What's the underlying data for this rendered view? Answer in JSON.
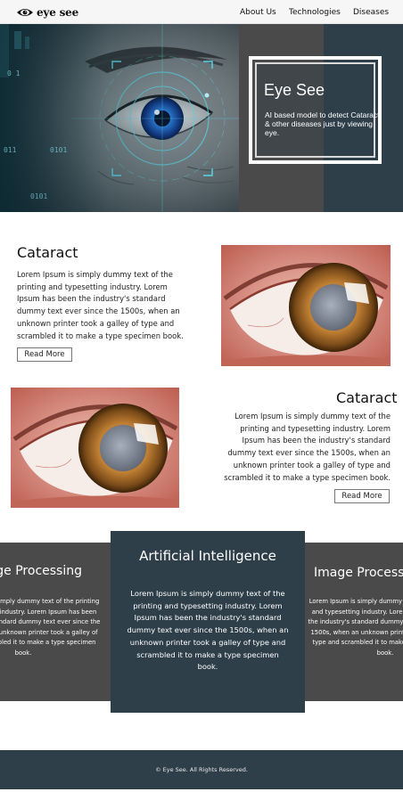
{
  "nav": {
    "logo_text": "eye see",
    "links": [
      "About Us",
      "Technologies",
      "Diseases"
    ]
  },
  "hero": {
    "title": "Eye See",
    "subtitle": "AI based model to detect Cataract & other diseases just by viewing eye.",
    "overlay_digits": [
      "0 1",
      "011",
      "0101",
      "0101"
    ]
  },
  "sections": [
    {
      "title": "Cataract",
      "body": "Lorem Ipsum is simply dummy text of the printing and typesetting industry. Lorem Ipsum has been the industry's standard dummy text ever since the 1500s, when an unknown printer took a galley of type and scrambled it to make a type specimen book.",
      "button": "Read More"
    },
    {
      "title": "Cataract",
      "body": "Lorem Ipsum is simply dummy text of the printing and typesetting industry. Lorem Ipsum has been the industry's standard dummy text ever since the 1500s, when an unknown printer took a galley of type and scrambled it to make a type specimen book.",
      "button": "Read More"
    }
  ],
  "cards": [
    {
      "title": "Image Processing",
      "body": "Lorem Ipsum is simply dummy text of the printing and typesetting industry. Lorem Ipsum has been the industry's standard dummy text ever since the 1500s, when an unknown printer took a galley of type and scrambled it to make a type specimen book."
    },
    {
      "title": "Artificial Intelligence",
      "body": "Lorem Ipsum is simply dummy text of the printing and typesetting industry. Lorem Ipsum has been the industry's standard dummy text ever since the 1500s, when an unknown printer took a galley of type and scrambled it to make a type specimen book."
    },
    {
      "title": "Image Processing",
      "body": "Lorem Ipsum is simply dummy text of the printing and typesetting industry. Lorem Ipsum has been the industry's standard dummy text ever since the 1500s, when an unknown printer took a galley of type and scrambled it to make a type specimen book."
    }
  ],
  "footer": {
    "copyright": "© Eye See. All Rights Reserved."
  },
  "colors": {
    "dark_slate": "#2f3f4a",
    "charcoal": "#4a4a4a",
    "iris_blue": "#2f86e8",
    "iris_amber": "#b8782c",
    "sclera_pink": "#e6a49a"
  },
  "icons": {
    "logo": "eye-logo-icon"
  }
}
